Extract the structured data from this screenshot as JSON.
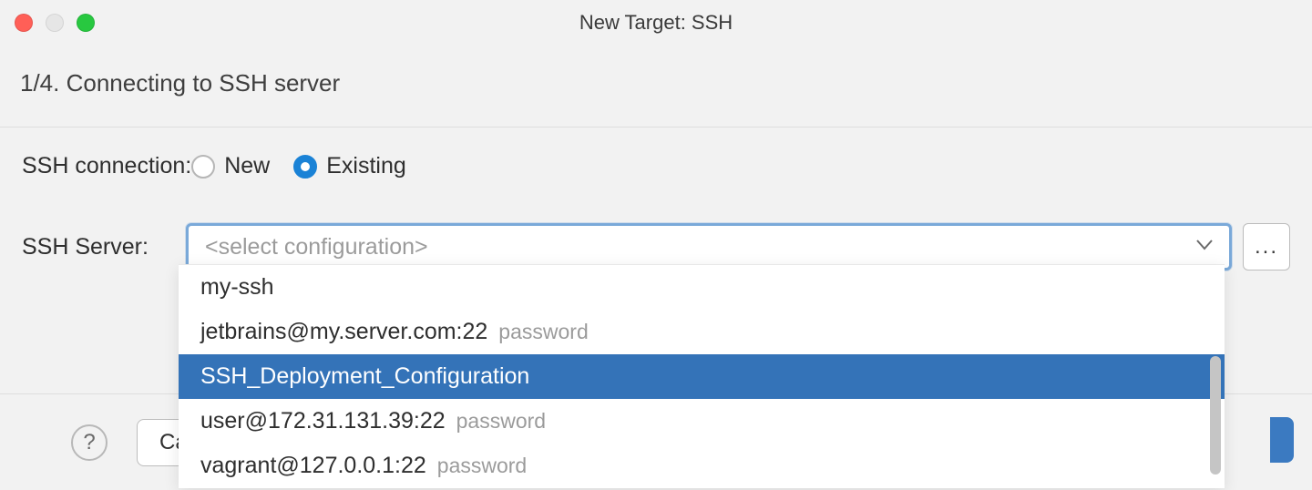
{
  "window": {
    "title": "New Target: SSH"
  },
  "step": {
    "label": "1/4. Connecting to SSH server"
  },
  "connection": {
    "label": "SSH connection:",
    "options": {
      "new": "New",
      "existing": "Existing"
    },
    "selected": "existing"
  },
  "server": {
    "label": "SSH Server:",
    "placeholder": "<select configuration>",
    "ellipsis": "...",
    "options": [
      {
        "label": "my-ssh",
        "hint": "",
        "selected": false
      },
      {
        "label": "jetbrains@my.server.com:22",
        "hint": "password",
        "selected": false
      },
      {
        "label": "SSH_Deployment_Configuration",
        "hint": "",
        "selected": true
      },
      {
        "label": "user@172.31.131.39:22",
        "hint": "password",
        "selected": false
      },
      {
        "label": "vagrant@127.0.0.1:22",
        "hint": "password",
        "selected": false
      }
    ]
  },
  "footer": {
    "help": "?",
    "cancel": "Ca"
  }
}
